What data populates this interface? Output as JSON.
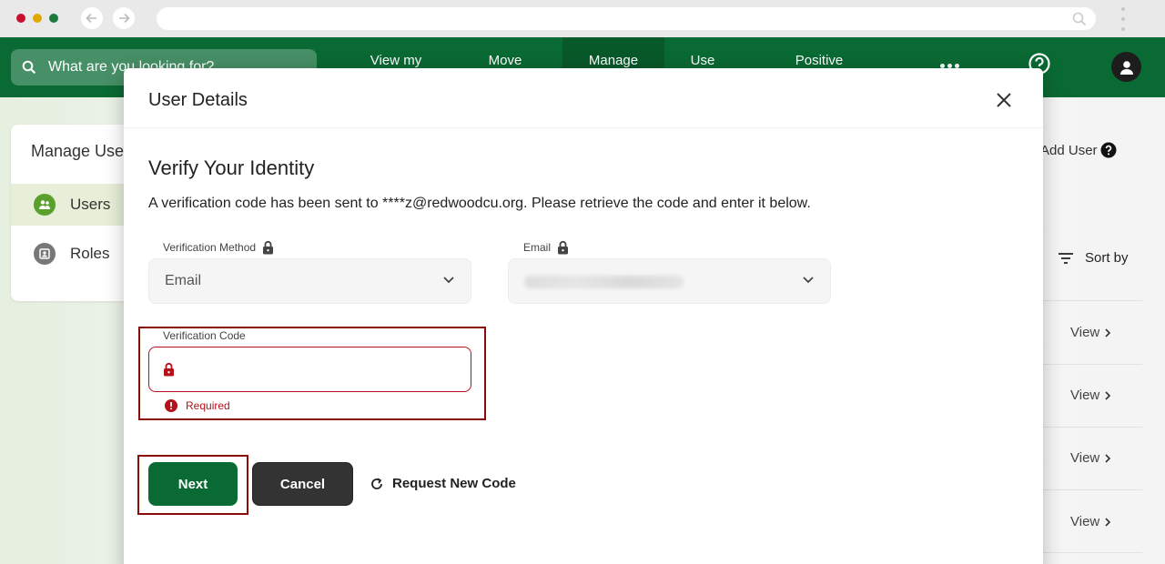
{
  "browser": {
    "icons": {
      "back": "arrow-left-icon",
      "forward": "arrow-right-icon",
      "search": "search-icon",
      "menu": "kebab-menu-icon"
    }
  },
  "header": {
    "search_placeholder": "What are you looking for?",
    "nav": [
      {
        "label": "View my",
        "active": false
      },
      {
        "label": "Move",
        "active": false
      },
      {
        "label": "Manage",
        "active": true
      },
      {
        "label": "Use",
        "active": false
      },
      {
        "label": "Positive",
        "active": false
      }
    ],
    "brand_color": "#0a6a33"
  },
  "sidebar": {
    "title": "Manage Users",
    "items": [
      {
        "label": "Users",
        "icon": "users-icon",
        "selected": true
      },
      {
        "label": "Roles",
        "icon": "roles-icon",
        "selected": false
      }
    ]
  },
  "main": {
    "add_user_label": "Add User",
    "sort_label": "Sort by",
    "rows": [
      {
        "action": "View"
      },
      {
        "action": "View"
      },
      {
        "action": "View"
      },
      {
        "action": "View"
      }
    ]
  },
  "modal": {
    "title": "User Details",
    "heading": "Verify Your Identity",
    "description": "A verification code has been sent to ****z@redwoodcu.org. Please retrieve the code and enter it below.",
    "method_label": "Verification Method",
    "method_value": "Email",
    "email_label": "Email",
    "code_label": "Verification Code",
    "code_value": "",
    "error_text": "Required",
    "next_label": "Next",
    "cancel_label": "Cancel",
    "request_label": "Request New Code",
    "error_color": "#b3121b"
  }
}
